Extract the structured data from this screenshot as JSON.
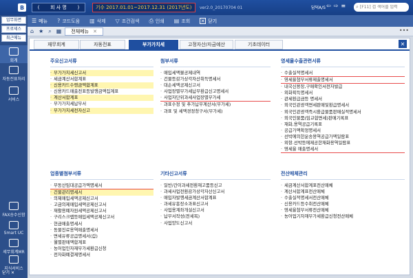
{
  "titlebar": {
    "logo": "B",
    "company_left": "(",
    "company_name": "회 사 명",
    "company_right": ")",
    "period": "기수  2017.01.01~2017.12.31  (2017년도)",
    "version": "ver2.0_20170704 01",
    "user": "담덕A/S",
    "search_placeholder": "[F11] 검 색어를 입력"
  },
  "leftnav": {
    "buttons": [
      "업무화면",
      "프로세스",
      "최근메뉴"
    ],
    "items": [
      "회계",
      "자동전표처리",
      "서비스",
      "FAX송수신함",
      "Smart UC",
      "세무회계MR",
      "지식서비스"
    ],
    "close_all": "닫기 ✕"
  },
  "toolbar": {
    "menu": "메뉴",
    "code": "코드도움",
    "delete": "삭제",
    "condition": "조건검색",
    "print": "인쇄",
    "view": "조회",
    "close": "닫기"
  },
  "tabstrip": {
    "tab": "전체메뉴",
    "dots": "•••"
  },
  "subtabs": [
    "재무회계",
    "자동전표",
    "부가가치세",
    "고정자산/자금예산",
    "기초데이터"
  ],
  "sections": {
    "s1": {
      "title": "주요신고서류",
      "items": [
        "부가가치세신고서",
        "세금계산서합계표",
        "신용카드수령금액합계표",
        "신용카드매출전표등발행금액집계표",
        "계산서합계표",
        "부가가치세납부서",
        "부가가치세전자신고"
      ]
    },
    "s2": {
      "title": "첨부서류",
      "items": [
        "매입세액불공제내역",
        "건물등감가상각자산취득명세서",
        "대손세액공제신고서",
        "사업장별부가세납부환급신고명세서",
        "사업자단위과세사업장별부가세",
        "과표수정 및 추가납부계산서(부가세)",
        "과표 및 세액경정청구서(부가세)"
      ]
    },
    "s3": {
      "title": "영세율수출관련서류",
      "items": [
        "수출실적명세서",
        "영세율첨부서류제출명세서",
        "내국신용장,구매확인서전자발급",
        "외화획득명세서",
        "관세환급금등 명세서",
        "외국인관광객면세판매및환급명세서",
        "외국인관광객즉시환급물품판매실적명세서",
        "외국인물품(임교합면세)판매기록표",
        "재화,용역공급기록표",
        "공급가액확정명세서",
        "선박에의한운송용역공급가액일람표",
        "외항.선박등에제공한재화용역일람표",
        "영세율 매출명세서"
      ]
    },
    "s4": {
      "title": "업종별첨부서류",
      "items": [
        "부동산임대공급가액명세서",
        "건물관리명세서",
        "의제매입세액공제신고서",
        "고금의제매입세액공제신고서",
        "재활용폐자원세액공제신고서",
        "구리스크랩등매입세액공제신고서",
        "현금매출명세서",
        "동물진료용역매출명세서",
        "면세유류공급명세서(갑)",
        "월별판매액합계표",
        "농어업인자재부가세환급신청",
        "전자화폐결제명세서"
      ]
    },
    "s5": {
      "title": "기타신고서류",
      "items": [
        "일반/간이과세전환재고품등신고",
        "과세사업전환감가상각자산신고서",
        "매입자발행세금계산서합계표",
        "과세유흥장소과표신고서",
        "사업용계좌개설신고서",
        "납부서작성(전세목)",
        "사업양도신고서"
      ]
    },
    "s6": {
      "title": "전산매체관리",
      "items": [
        "세금계산서합계표전산매체",
        "계산서합계표전산매체",
        "수출실적명세서전산매체",
        "신용카드등수취전산매체",
        "영세율첨부서류전산매체",
        "농어업기자재부가세환급신청전산매체"
      ]
    }
  }
}
